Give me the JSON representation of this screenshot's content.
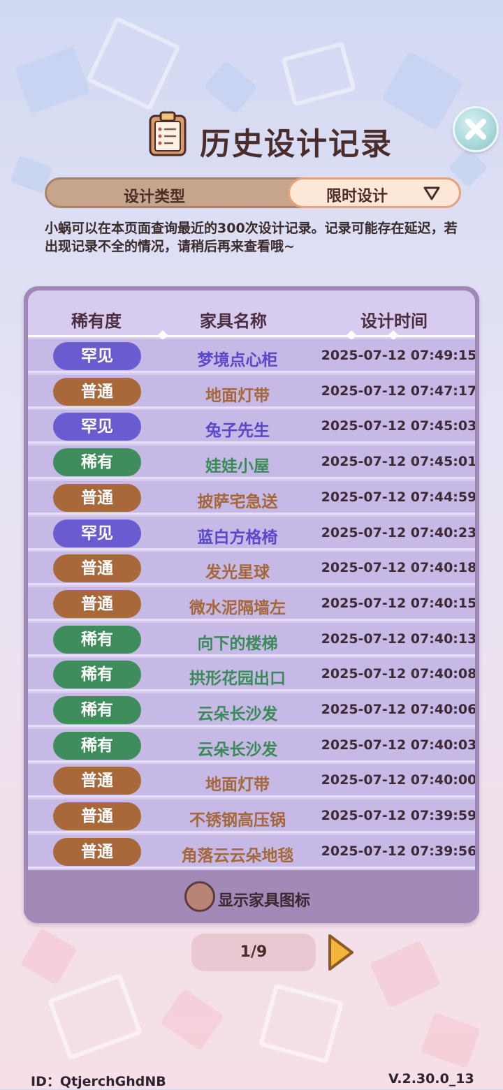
{
  "header": {
    "title": "历史设计记录"
  },
  "filter": {
    "label": "设计类型",
    "selected": "限时设计"
  },
  "description": "小蜗可以在本页面查询最近的300次设计记录。记录可能存在延迟，若出现记录不全的情况，请稍后再来查看哦~",
  "table": {
    "columns": [
      "稀有度",
      "家具名称",
      "设计时间"
    ],
    "rows": [
      {
        "rarity": "罕见",
        "rarity_level": 0,
        "name": "梦境点心柜",
        "time": "2025-07-12 07:49:15"
      },
      {
        "rarity": "普通",
        "rarity_level": 1,
        "name": "地面灯带",
        "time": "2025-07-12 07:47:17"
      },
      {
        "rarity": "罕见",
        "rarity_level": 0,
        "name": "兔子先生",
        "time": "2025-07-12 07:45:03"
      },
      {
        "rarity": "稀有",
        "rarity_level": 2,
        "name": "娃娃小屋",
        "time": "2025-07-12 07:45:01"
      },
      {
        "rarity": "普通",
        "rarity_level": 1,
        "name": "披萨宅急送",
        "time": "2025-07-12 07:44:59"
      },
      {
        "rarity": "罕见",
        "rarity_level": 0,
        "name": "蓝白方格椅",
        "time": "2025-07-12 07:40:23"
      },
      {
        "rarity": "普通",
        "rarity_level": 1,
        "name": "发光星球",
        "time": "2025-07-12 07:40:18"
      },
      {
        "rarity": "普通",
        "rarity_level": 1,
        "name": "微水泥隔墙左",
        "time": "2025-07-12 07:40:15"
      },
      {
        "rarity": "稀有",
        "rarity_level": 2,
        "name": "向下的楼梯",
        "time": "2025-07-12 07:40:13"
      },
      {
        "rarity": "稀有",
        "rarity_level": 2,
        "name": "拱形花园出口",
        "time": "2025-07-12 07:40:08"
      },
      {
        "rarity": "稀有",
        "rarity_level": 2,
        "name": "云朵长沙发",
        "time": "2025-07-12 07:40:06"
      },
      {
        "rarity": "稀有",
        "rarity_level": 2,
        "name": "云朵长沙发",
        "time": "2025-07-12 07:40:03"
      },
      {
        "rarity": "普通",
        "rarity_level": 1,
        "name": "地面灯带",
        "time": "2025-07-12 07:40:00"
      },
      {
        "rarity": "普通",
        "rarity_level": 1,
        "name": "不锈钢高压锅",
        "time": "2025-07-12 07:39:59"
      },
      {
        "rarity": "普通",
        "rarity_level": 1,
        "name": "角落云云朵地毯",
        "time": "2025-07-12 07:39:56"
      }
    ]
  },
  "footer": {
    "toggle_label": "显示家具图标"
  },
  "pagination": {
    "text": "1/9"
  },
  "meta": {
    "id": "ID：QtjerchGhdNB",
    "version": "V.2.30.0_13"
  },
  "colors": {
    "rare_purple": "#6b5bd0",
    "common_brown": "#a8683a",
    "uncommon_green": "#3f8c5c"
  },
  "icons": {
    "title_icon": "clipboard-icon",
    "close": "close-icon",
    "dropdown": "triangle-down-icon",
    "next": "next-arrow-icon"
  }
}
